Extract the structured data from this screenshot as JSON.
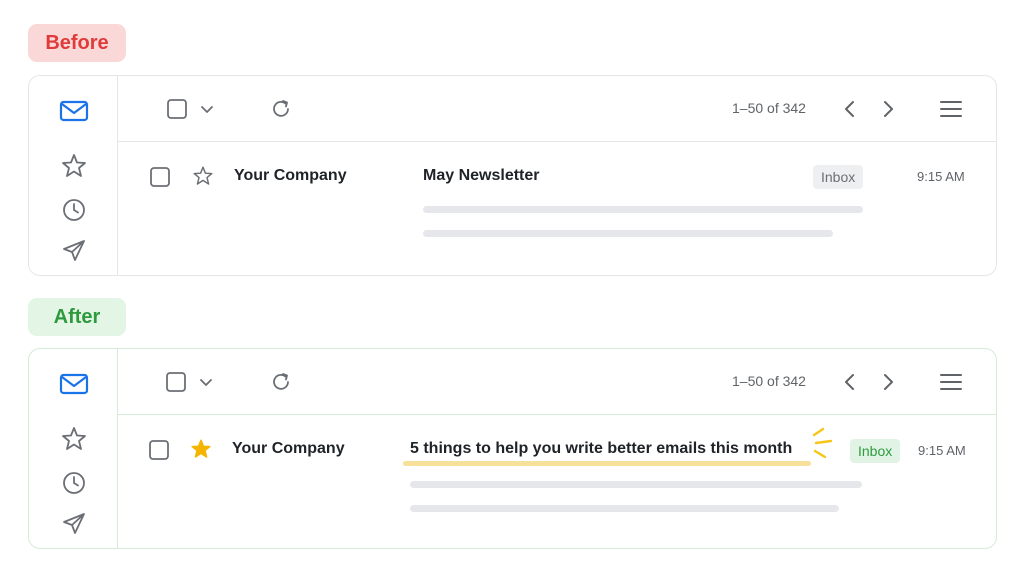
{
  "before": {
    "badge": "Before",
    "toolbar": {
      "range": "1–50 of 342"
    },
    "row": {
      "sender": "Your Company",
      "subject": "May Newsletter",
      "label": "Inbox",
      "time": "9:15 AM",
      "starred": false
    }
  },
  "after": {
    "badge": "After",
    "toolbar": {
      "range": "1–50 of 342"
    },
    "row": {
      "sender": "Your Company",
      "subject": "5 things to help you write better emails this month",
      "label": "Inbox",
      "time": "9:15 AM",
      "starred": true
    }
  },
  "icons": {
    "mail": "mail-icon",
    "star": "star-icon",
    "clock": "clock-icon",
    "send": "send-icon",
    "checkbox": "checkbox-icon",
    "chevron": "chevron-down-icon",
    "refresh": "refresh-icon",
    "prev": "chevron-left-icon",
    "next": "chevron-right-icon",
    "menu": "menu-icon",
    "sparkle": "sparkle-icon"
  },
  "colors": {
    "before_badge_bg": "#fbd8d8",
    "before_badge_text": "#e03b3b",
    "after_badge_bg": "#e3f5e5",
    "after_badge_text": "#2e9a3e",
    "mail_blue": "#1a73e8",
    "star_gold": "#f5b400",
    "highlight": "#f6e09a"
  }
}
